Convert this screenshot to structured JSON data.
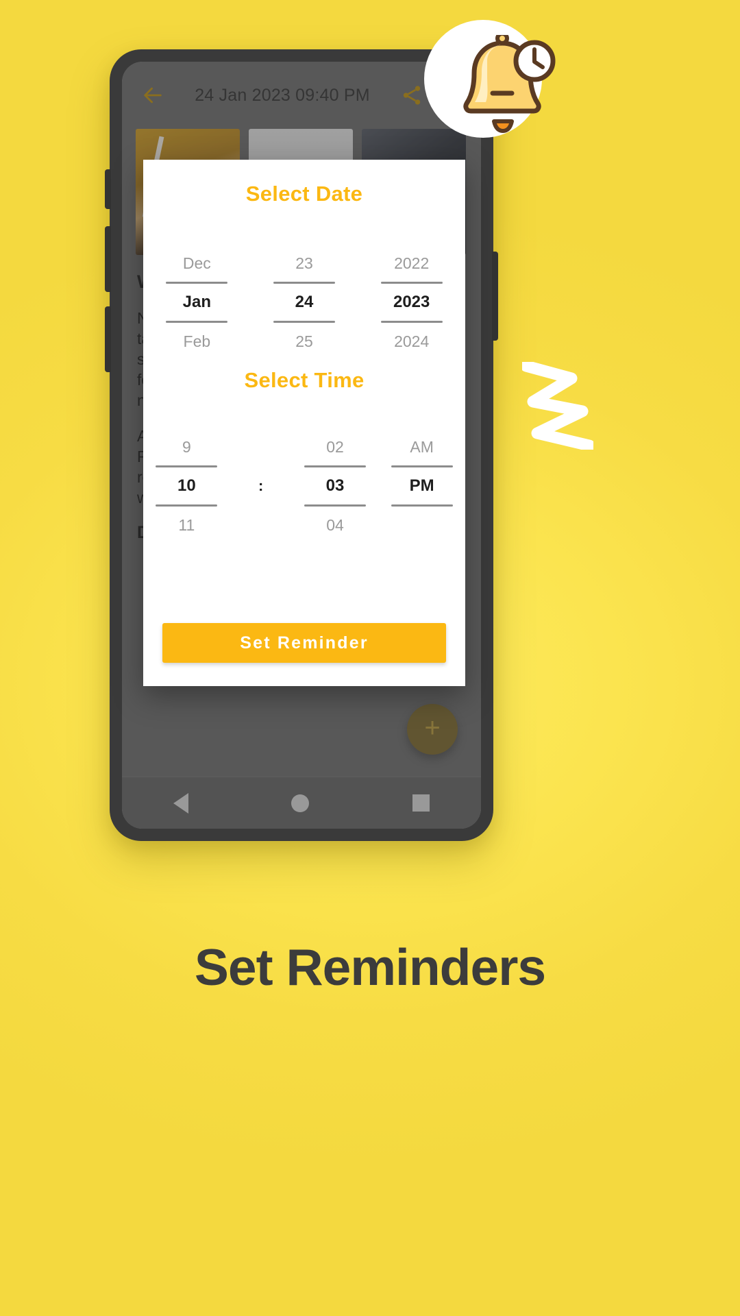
{
  "headline": "Set Reminders",
  "phone": {
    "appbar": {
      "back_icon": "arrow-left-icon",
      "title": "24 Jan 2023 09:40 PM",
      "share_icon": "share-icon",
      "palette_icon": "palette-icon"
    },
    "note": {
      "title": "W",
      "paragraph1": "N\nta\ns\nfe\nn",
      "paragraph2": "A\nR\nre\nw",
      "heading2": "D"
    },
    "fab": {
      "label": "+",
      "icon": "plus-icon"
    },
    "navbar": {
      "back": "nav-back-icon",
      "home": "nav-home-icon",
      "recents": "nav-recents-icon"
    }
  },
  "dialog": {
    "date_title": "Select Date",
    "time_title": "Select Time",
    "date": {
      "month": {
        "prev": "Dec",
        "selected": "Jan",
        "next": "Feb"
      },
      "day": {
        "prev": "23",
        "selected": "24",
        "next": "25"
      },
      "year": {
        "prev": "2022",
        "selected": "2023",
        "next": "2024"
      }
    },
    "time": {
      "hour": {
        "prev": "9",
        "selected": "10",
        "next": "11"
      },
      "separator": ":",
      "minute": {
        "prev": "02",
        "selected": "03",
        "next": "04"
      },
      "meridiem": {
        "prev": "AM",
        "selected": "PM",
        "next": ""
      }
    },
    "submit_label": "Set Reminder"
  },
  "decor": {
    "bell_icon": "bell-clock-icon",
    "zigzag": "zigzag-shape"
  },
  "colors": {
    "background": "#fbe44f",
    "accent": "#fbb813",
    "dialog_bg": "#ffffff",
    "phone_frame": "#3a3a3a",
    "headline": "#3c3c3c"
  }
}
